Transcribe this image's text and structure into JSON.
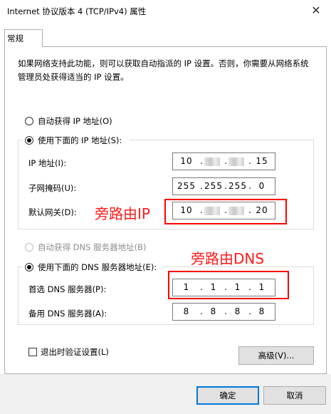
{
  "window": {
    "title": "Internet 协议版本 4 (TCP/IPv4) 属性",
    "close_glyph": "✕"
  },
  "tabs": [
    {
      "label": "常规"
    }
  ],
  "description": "如果网络支持此功能，则可以获取自动指派的 IP 设置。否则，你需要从网络系统管理员处获得适当的 IP 设置。",
  "ip_mode": {
    "auto_label": "自动获得 IP 地址(O)",
    "manual_label": "使用下面的 IP 地址(S):",
    "selected": "manual"
  },
  "ip_fields": {
    "ip": {
      "label": "IP 地址(I):",
      "octets": [
        "10",
        "",
        "",
        "15"
      ]
    },
    "mask": {
      "label": "子网掩码(U):",
      "octets": [
        "255",
        "255",
        "255",
        "0"
      ]
    },
    "gateway": {
      "label": "默认网关(D):",
      "octets": [
        "10",
        "",
        "",
        "20"
      ]
    }
  },
  "dns_mode": {
    "auto_label": "自动获得 DNS 服务器地址(B)",
    "manual_label": "使用下面的 DNS 服务器地址(E):",
    "selected": "manual",
    "auto_disabled": true
  },
  "dns_fields": {
    "preferred": {
      "label": "首选 DNS 服务器(P):",
      "octets": [
        "1",
        "1",
        "1",
        "1"
      ]
    },
    "alternate": {
      "label": "备用 DNS 服务器(A):",
      "octets": [
        "8",
        "8",
        "8",
        "8"
      ]
    }
  },
  "validate": {
    "label": "退出时验证设置(L)",
    "checked": false
  },
  "buttons": {
    "advanced": "高级(V)...",
    "ok": "确定",
    "cancel": "取消"
  },
  "annotations": {
    "gateway_note": "旁路由IP",
    "dns_note": "旁路由DNS",
    "color": "#ff0000"
  }
}
